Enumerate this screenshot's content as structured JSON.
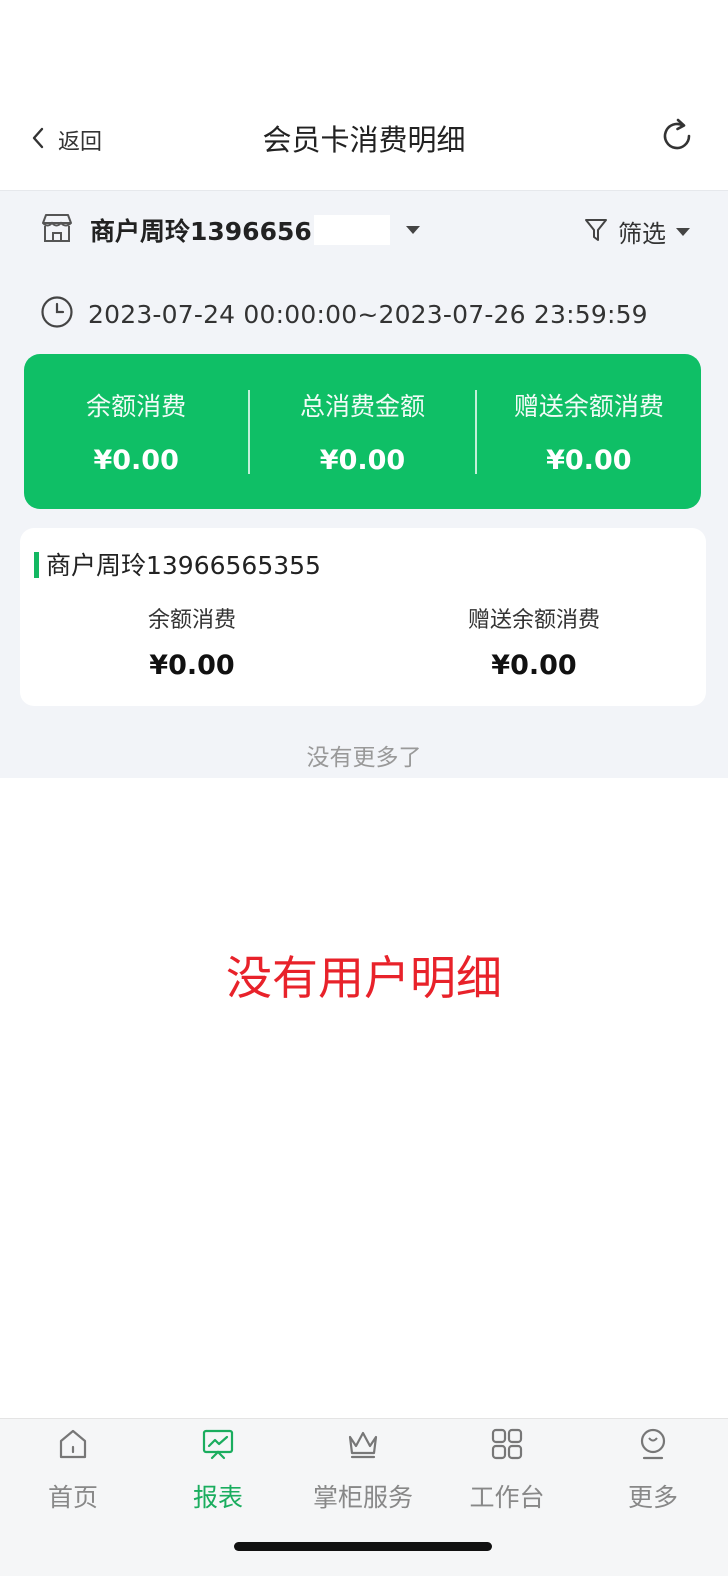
{
  "header": {
    "back_label": "返回",
    "title": "会员卡消费明细"
  },
  "filters": {
    "merchant": "商户周玲1396656",
    "filter_label": "筛选",
    "date_range": "2023-07-24 00:00:00~2023-07-26 23:59:59"
  },
  "summary": [
    {
      "label": "余额消费",
      "value": "¥0.00"
    },
    {
      "label": "总消费金额",
      "value": "¥0.00"
    },
    {
      "label": "赠送余额消费",
      "value": "¥0.00"
    }
  ],
  "detail": {
    "merchant": "商户周玲13966565355",
    "items": [
      {
        "label": "余额消费",
        "value": "¥0.00"
      },
      {
        "label": "赠送余额消费",
        "value": "¥0.00"
      }
    ]
  },
  "list_end_text": "没有更多了",
  "annotation": "没有用户明细",
  "tabs": [
    {
      "label": "首页",
      "icon": "home-icon",
      "active": false
    },
    {
      "label": "报表",
      "icon": "report-icon",
      "active": true
    },
    {
      "label": "掌柜服务",
      "icon": "crown-icon",
      "active": false
    },
    {
      "label": "工作台",
      "icon": "grid-icon",
      "active": false
    },
    {
      "label": "更多",
      "icon": "more-icon",
      "active": false
    }
  ],
  "colors": {
    "accent": "#0fbf66",
    "tab_active": "#1aad5e",
    "annotation": "#e8222a"
  }
}
